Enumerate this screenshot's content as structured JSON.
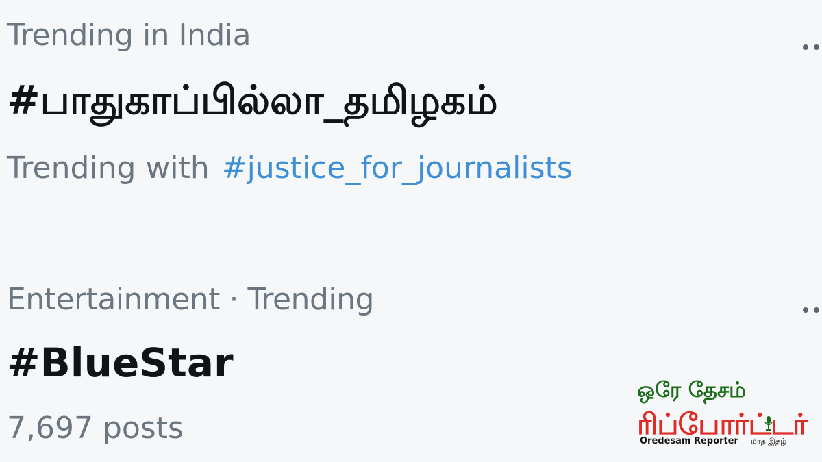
{
  "trends": [
    {
      "context": "Trending in India",
      "title": "#பாதுகாப்பில்லா_தமிழகம்",
      "with_label": "Trending with",
      "with_link": "#justice_for_journalists"
    },
    {
      "context": "Entertainment · Trending",
      "title": "#BlueStar",
      "posts": "7,697 posts"
    }
  ],
  "more_icon": "more-horizontal-icon",
  "logo": {
    "top": "ஒரே தேசம்",
    "main": "ரிப்போர்ட்டர்",
    "sub": "Oredesam Reporter",
    "sub2": "மாத இதழ்",
    "colors": {
      "top": "#1a6b1a",
      "main": "#e02a24"
    }
  },
  "colors": {
    "muted": "#6b7680",
    "link": "#3f8fd6",
    "title": "#0f1419",
    "background": "#f5f7f8"
  }
}
